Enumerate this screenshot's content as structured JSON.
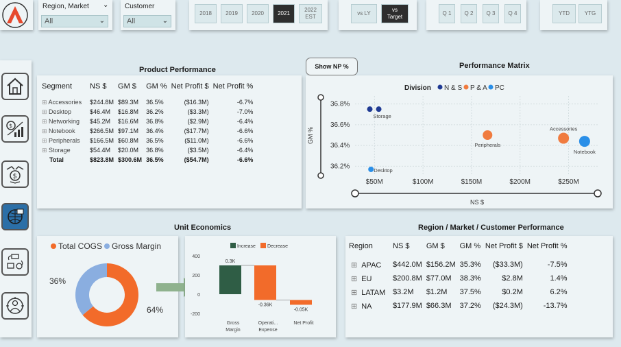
{
  "filters": {
    "region_label": "Region, Market",
    "region_value": "All",
    "customer_label": "Customer",
    "customer_value": "All"
  },
  "years": [
    "2018",
    "2019",
    "2020",
    "2021",
    "2022 EST"
  ],
  "years_active": "2021",
  "compare": [
    "vs LY",
    "vs Target"
  ],
  "compare_active": "vs Target",
  "quarters": [
    "Q 1",
    "Q 2",
    "Q 3",
    "Q 4"
  ],
  "period": [
    "YTD",
    "YTG"
  ],
  "show_np_label": "Show NP %",
  "product": {
    "title": "Product Performance",
    "headers": [
      "Segment",
      "NS $",
      "GM $",
      "GM %",
      "Net Profit $",
      "Net Profit %"
    ],
    "rows": [
      [
        "Accessories",
        "$244.8M",
        "$89.3M",
        "36.5%",
        "($16.3M)",
        "-6.7%"
      ],
      [
        "Desktop",
        "$46.4M",
        "$16.8M",
        "36.2%",
        "($3.3M)",
        "-7.0%"
      ],
      [
        "Networking",
        "$45.2M",
        "$16.6M",
        "36.8%",
        "($2.9M)",
        "-6.4%"
      ],
      [
        "Notebook",
        "$266.5M",
        "$97.1M",
        "36.4%",
        "($17.7M)",
        "-6.6%"
      ],
      [
        "Peripherals",
        "$166.5M",
        "$60.8M",
        "36.5%",
        "($11.0M)",
        "-6.6%"
      ],
      [
        "Storage",
        "$54.4M",
        "$20.0M",
        "36.8%",
        "($3.5M)",
        "-6.4%"
      ]
    ],
    "total": [
      "Total",
      "$823.8M",
      "$300.6M",
      "36.5%",
      "($54.7M)",
      "-6.6%"
    ]
  },
  "matrix": {
    "title": "Performance Matrix",
    "legend_title": "Division",
    "legend": [
      {
        "name": "N & S",
        "color": "#1f3a93"
      },
      {
        "name": "P & A",
        "color": "#f07b3f"
      },
      {
        "name": "PC",
        "color": "#2a8fe8"
      }
    ],
    "ylabel": "GM %",
    "xlabel": "NS $",
    "y_ticks": [
      "36.8%",
      "36.6%",
      "36.4%",
      "36.2%"
    ],
    "x_ticks": [
      "$50M",
      "$100M",
      "$150M",
      "$200M",
      "$250M"
    ]
  },
  "chart_data": [
    {
      "type": "scatter",
      "title": "Performance Matrix",
      "xlabel": "NS $",
      "ylabel": "GM %",
      "xlim": [
        30,
        280
      ],
      "ylim": [
        36.15,
        36.85
      ],
      "x_ticks": [
        "$50M",
        "$100M",
        "$150M",
        "$200M",
        "$250M"
      ],
      "y_ticks": [
        "36.8%",
        "36.6%",
        "36.4%",
        "36.2%"
      ],
      "points": [
        {
          "label": "Storage",
          "x": 54.4,
          "y": 36.75,
          "division": "N & S",
          "color": "#1f3a93",
          "r": 4
        },
        {
          "label": "",
          "x": 45.2,
          "y": 36.75,
          "division": "N & S",
          "color": "#1f3a93",
          "r": 4
        },
        {
          "label": "Peripherals",
          "x": 166.5,
          "y": 36.5,
          "division": "P & A",
          "color": "#f07b3f",
          "r": 7
        },
        {
          "label": "Accessories",
          "x": 244.8,
          "y": 36.47,
          "division": "P & A",
          "color": "#f07b3f",
          "r": 8
        },
        {
          "label": "Notebook",
          "x": 266.5,
          "y": 36.44,
          "division": "PC",
          "color": "#2a8fe8",
          "r": 8
        },
        {
          "label": "Desktop",
          "x": 46.4,
          "y": 36.17,
          "division": "PC",
          "color": "#2a8fe8",
          "r": 4
        }
      ]
    },
    {
      "type": "pie",
      "title": "",
      "labels": [
        "Total COGS",
        "Gross Margin"
      ],
      "values": [
        64,
        36
      ],
      "value_labels": [
        "64%",
        "36%"
      ],
      "colors": [
        "#f26b2a",
        "#8aaee0"
      ]
    },
    {
      "type": "bar",
      "title": "",
      "categories": [
        "Gross Margin",
        "Operational Expense",
        "Net Profit"
      ],
      "values": [
        0.3,
        -0.36,
        -0.05
      ],
      "data_labels": [
        "0.3K",
        "-0.36K",
        "-0.05K"
      ],
      "legend": [
        "Increase",
        "Decrease"
      ],
      "colors": {
        "increase": "#2f5d45",
        "decrease": "#f26b2a"
      },
      "y_ticks": [
        "400",
        "200",
        "0",
        "-200"
      ],
      "ylim": [
        -250,
        400
      ]
    }
  ],
  "unit": {
    "title": "Unit Economics",
    "donut_legend": [
      "Total COGS",
      "Gross Margin"
    ],
    "donut_labels": [
      "36%",
      "64%"
    ],
    "waterfall_legend": [
      "Increase",
      "Decrease"
    ],
    "waterfall_cats": [
      "Gross Margin",
      "Operati... Expense",
      "Net Profit"
    ]
  },
  "region": {
    "title": "Region / Market / Customer Performance",
    "headers": [
      "Region",
      "NS $",
      "GM $",
      "GM %",
      "Net Profit $",
      "Net Profit %"
    ],
    "rows": [
      [
        "APAC",
        "$442.0M",
        "$156.2M",
        "35.3%",
        "($33.3M)",
        "-7.5%"
      ],
      [
        "EU",
        "$200.8M",
        "$77.0M",
        "38.3%",
        "$2.8M",
        "1.4%"
      ],
      [
        "LATAM",
        "$3.2M",
        "$1.2M",
        "37.5%",
        "$0.2M",
        "6.2%"
      ],
      [
        "NA",
        "$177.9M",
        "$66.3M",
        "37.2%",
        "($24.3M)",
        "-13.7%"
      ]
    ]
  }
}
